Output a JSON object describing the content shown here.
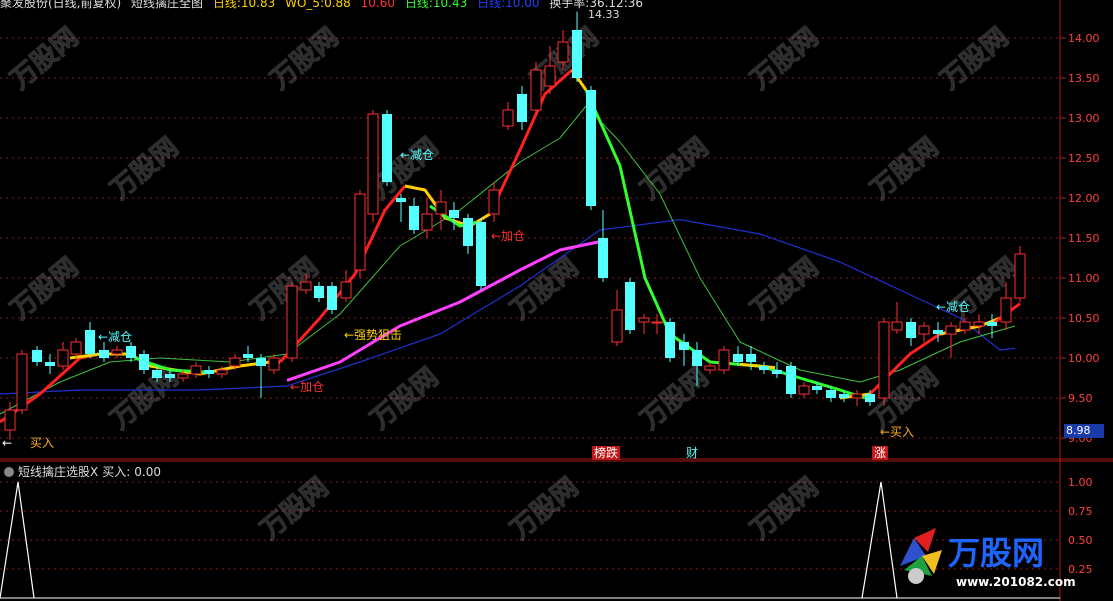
{
  "header": {
    "indicator_name": "聚发股份(日线,前复权)",
    "formula": "短线擒庄全图",
    "ma5": "日线:10.83",
    "wo": "WO_5:0.88",
    "mid": "10.60",
    "ma2": "日线:10.43",
    "ma3": "日线:10.00",
    "turnover": "换手率:36.12:36"
  },
  "high_label": "14.33",
  "low_label": "8.98",
  "current_price_box": "8.98",
  "annotations": {
    "buy1": "买入",
    "reduce1": "←减仓",
    "add1": "←加仓",
    "strong": "←强势狙击",
    "reduce2": "←减仓",
    "add2": "←加仓",
    "reduce3": "←减仓",
    "buy2": "←买入"
  },
  "event_tags": {
    "bang_die": "榜跌",
    "cai": "财",
    "zhang": "涨"
  },
  "indicator_panel": {
    "title": "短线擒庄选股X",
    "value_label": "买入:",
    "value": "0.00"
  },
  "price_axis": [
    "14.00",
    "13.50",
    "13.00",
    "12.50",
    "12.00",
    "11.50",
    "11.00",
    "10.50",
    "10.00",
    "9.50",
    "9.00"
  ],
  "indicator_axis": [
    "1.00",
    "0.75",
    "0.50",
    "0.25"
  ],
  "watermark_text": "万股网",
  "logo": {
    "name": "万股网",
    "url": "www.201082.com"
  },
  "colors": {
    "up": "#ff3030",
    "down": "#54ffff",
    "ma_red": "#ff2020",
    "ma_yellow": "#ffd000",
    "ma_green_thick": "#30ff30",
    "ma_thin_green": "#40c040",
    "ma_magenta": "#ff40ff",
    "ma_blue": "#2030d0"
  }
}
